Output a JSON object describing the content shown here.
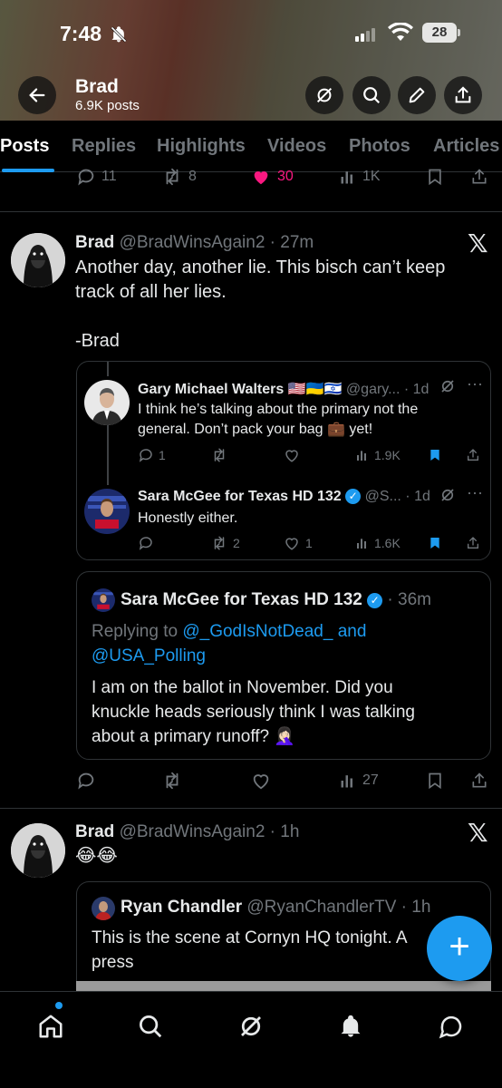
{
  "status_bar": {
    "time": "7:48",
    "battery": "28"
  },
  "profile": {
    "name": "Brad",
    "post_count": "6.9K posts"
  },
  "tabs": [
    "Posts",
    "Replies",
    "Highlights",
    "Videos",
    "Photos",
    "Articles"
  ],
  "prev_post_actions": {
    "replies": "11",
    "reposts": "8",
    "likes": "30",
    "views": "1K"
  },
  "post1": {
    "name": "Brad",
    "handle_time": "@BradWinsAgain2 · 27m",
    "text_line1": "Another day, another lie. This bisch can’t keep",
    "text_line2": "track of all her lies.",
    "signature": "-Brad",
    "quote": {
      "reply1": {
        "name": "Gary Michael Walters 🇺🇸🇺🇦🇮🇱",
        "handle_time": "@gary... · 1d",
        "text_line1": "I think he’s talking about the primary not the",
        "text_line2": "general. Don’t pack your bag 💼 yet!",
        "replies": "1",
        "views": "1.9K"
      },
      "reply2": {
        "name": "Sara McGee for Texas HD 132",
        "handle_time": "@S... · 1d",
        "text": "Honestly either.",
        "reposts": "2",
        "likes": "1",
        "views": "1.6K"
      }
    },
    "main_quote": {
      "name": "Sara McGee for Texas HD 132",
      "time": "· 36m",
      "replying_prefix": "Replying to",
      "replying_to1": "@_GodIsNotDead_ and",
      "replying_to2": "@USA_Polling",
      "text_line1": "I am on the ballot in November. Did you",
      "text_line2": "knuckle heads seriously think I was talking",
      "text_line3": "about a primary runoff? 🤦🏻‍♀️"
    },
    "actions": {
      "views": "27"
    }
  },
  "post2": {
    "name": "Brad",
    "handle_time": "@BradWinsAgain2 · 1h",
    "text": "😂😂",
    "quote": {
      "name": "Ryan Chandler",
      "handle_time": "@RyanChandlerTV · 1h",
      "text_line1": "This is the scene at Cornyn HQ tonight. A",
      "text_line2": "press"
    }
  },
  "fab_label": "+",
  "colors": {
    "accent": "#1d9bf0",
    "like": "#f91880",
    "muted": "#71767b",
    "text": "#e7e9ea"
  }
}
